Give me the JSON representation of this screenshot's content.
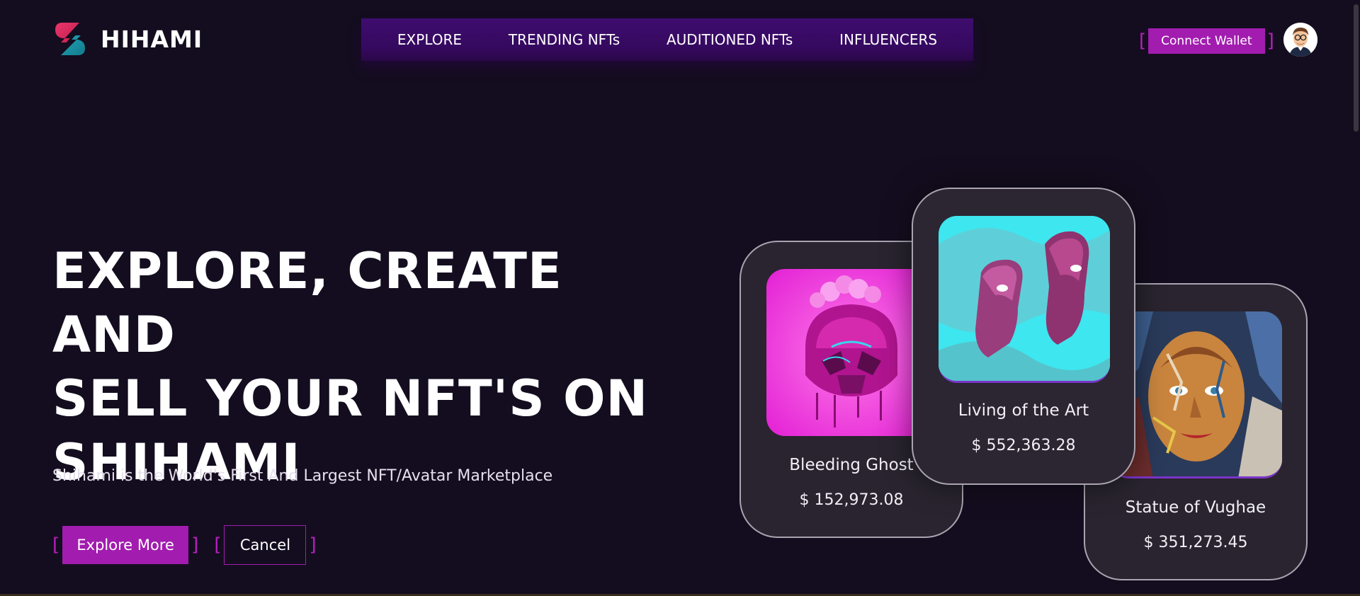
{
  "brand": {
    "name": "HIHAMI"
  },
  "nav": {
    "items": [
      {
        "label": "EXPLORE"
      },
      {
        "label": "TRENDING NFTs"
      },
      {
        "label": "AUDITIONED NFTs"
      },
      {
        "label": "INFLUENCERS"
      }
    ]
  },
  "header": {
    "connect_label": "Connect Wallet"
  },
  "hero": {
    "title_line1": "EXPLORE, CREATE AND",
    "title_line2": "SELL YOUR NFT'S ON",
    "title_line3": "SHIHAMI",
    "subtitle": "Shihami is the World's First And Largest NFT/Avatar Marketplace",
    "explore_label": "Explore More",
    "cancel_label": "Cancel"
  },
  "cards": [
    {
      "name": "Bleeding Ghost",
      "price": "$ 152,973.08"
    },
    {
      "name": "Living of the Art",
      "price": "$ 552,363.28"
    },
    {
      "name": "Statue of Vughae",
      "price": "$ 351,273.45"
    }
  ],
  "colors": {
    "background": "#140d1f",
    "nav_bg": "#3e0d6e",
    "accent": "#a21caf",
    "card_bg": "#29242f"
  }
}
